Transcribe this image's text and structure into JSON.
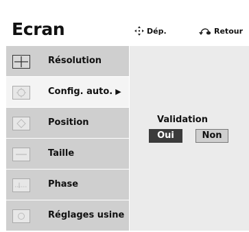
{
  "header": {
    "title": "Ecran",
    "move_hint": {
      "icon": "four-way-arrows-icon",
      "label": "Dép."
    },
    "back_hint": {
      "icon": "return-arrow-icon",
      "label": "Retour"
    }
  },
  "menu": {
    "items": [
      {
        "label": "Résolution",
        "icon": "resolution-icon"
      },
      {
        "label": "Config. auto.",
        "icon": "auto-config-icon",
        "selected": true,
        "arrow": "▶"
      },
      {
        "label": "Position",
        "icon": "position-icon"
      },
      {
        "label": "Taille",
        "icon": "size-icon"
      },
      {
        "label": "Phase",
        "icon": "phase-icon"
      },
      {
        "label": "Réglages usine",
        "icon": "factory-reset-icon"
      }
    ]
  },
  "dialog": {
    "label": "Validation",
    "yes_label": "Oui",
    "no_label": "Non",
    "selected": "Oui"
  },
  "colors": {
    "menu_bg": "#cfcfcf",
    "menu_selected_bg": "#f4f4f4",
    "panel_bg": "#ebebeb",
    "button_selected": "#3b3b3b"
  }
}
